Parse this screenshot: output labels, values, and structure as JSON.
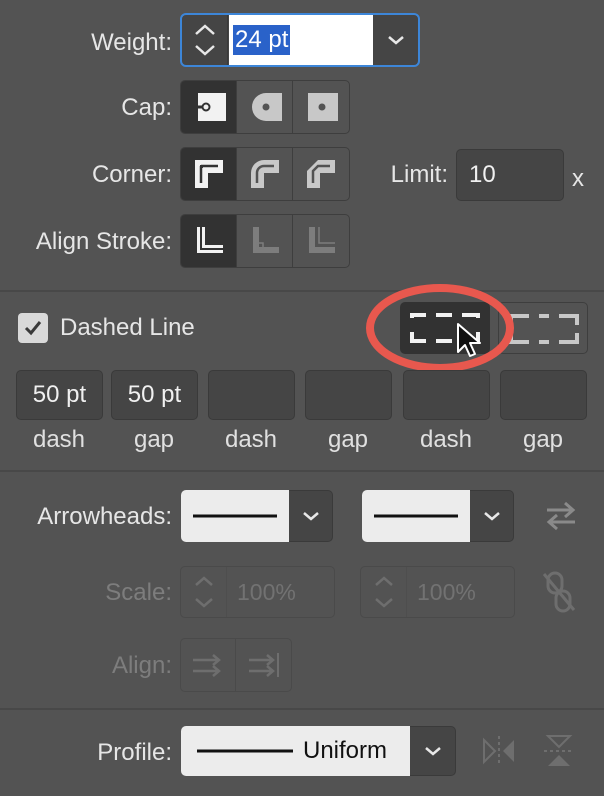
{
  "weight": {
    "label": "Weight:",
    "value": "24 pt"
  },
  "cap": {
    "label": "Cap:",
    "options": [
      "butt-cap",
      "round-cap",
      "projecting-cap"
    ],
    "selected": 0
  },
  "corner": {
    "label": "Corner:",
    "options": [
      "miter-join",
      "round-join",
      "bevel-join"
    ],
    "selected": 0
  },
  "limit": {
    "label": "Limit:",
    "value": "10",
    "unit": "x"
  },
  "align_stroke": {
    "label": "Align Stroke:",
    "options": [
      "align-center",
      "align-inside",
      "align-outside"
    ],
    "selected": 0
  },
  "dashed_line": {
    "label": "Dashed Line",
    "checked": true
  },
  "dashes": [
    {
      "value": "50 pt",
      "label": "dash"
    },
    {
      "value": "50 pt",
      "label": "gap"
    },
    {
      "value": "",
      "label": "dash"
    },
    {
      "value": "",
      "label": "gap"
    },
    {
      "value": "",
      "label": "dash"
    },
    {
      "value": "",
      "label": "gap"
    }
  ],
  "arrowheads": {
    "label": "Arrowheads:"
  },
  "scale": {
    "label": "Scale:",
    "start": "100%",
    "end": "100%"
  },
  "align": {
    "label": "Align:"
  },
  "profile": {
    "label": "Profile:",
    "value": "Uniform"
  },
  "colors": {
    "panel": "#535353",
    "highlight_ring": "#e8584e",
    "selection": "#2a62c9",
    "focus": "#3d86d8"
  }
}
